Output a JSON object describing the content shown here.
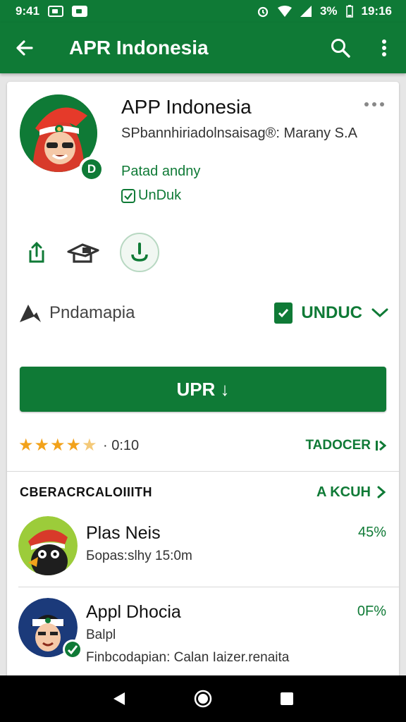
{
  "status_bar": {
    "time_left": "9:41",
    "battery": "3%",
    "time_right": "19:16"
  },
  "app_bar": {
    "title": "APR Indonesia",
    "back_icon": "arrow-back-icon",
    "search_icon": "search-icon",
    "menu_icon": "more-vert-icon"
  },
  "app": {
    "name": "APP Indonesia",
    "developer": "SPbannhiriadolnsaisag®: Marany S.A",
    "category": "Patad andny",
    "unduk_label": "UnDuk",
    "icon_badge": "D"
  },
  "actions": {
    "share_icon": "share-icon",
    "wishlist_icon": "wishlist-icon",
    "install_icon": "download-icon"
  },
  "meta": {
    "publisher": "Pndamapia",
    "unduc_label": "UNDUC"
  },
  "main_button": {
    "label": "UPR ↓"
  },
  "rating": {
    "stars": 5,
    "value": "· 0:10",
    "link": "TADOCER"
  },
  "section": {
    "title": "CBERACRCALOIIITH",
    "link": "A KCUH"
  },
  "list": [
    {
      "name": "Plas Neis",
      "sub": "Бораs:slhy 15:0m",
      "pct": "45%"
    },
    {
      "name": "Appl Dhocia",
      "sub": "Balpl",
      "sub2": "Finbcodapian: Calan Iaizer.renaita",
      "pct": "0F%"
    }
  ],
  "colors": {
    "brand_green": "#0f7a36",
    "star": "#f2a21b"
  }
}
